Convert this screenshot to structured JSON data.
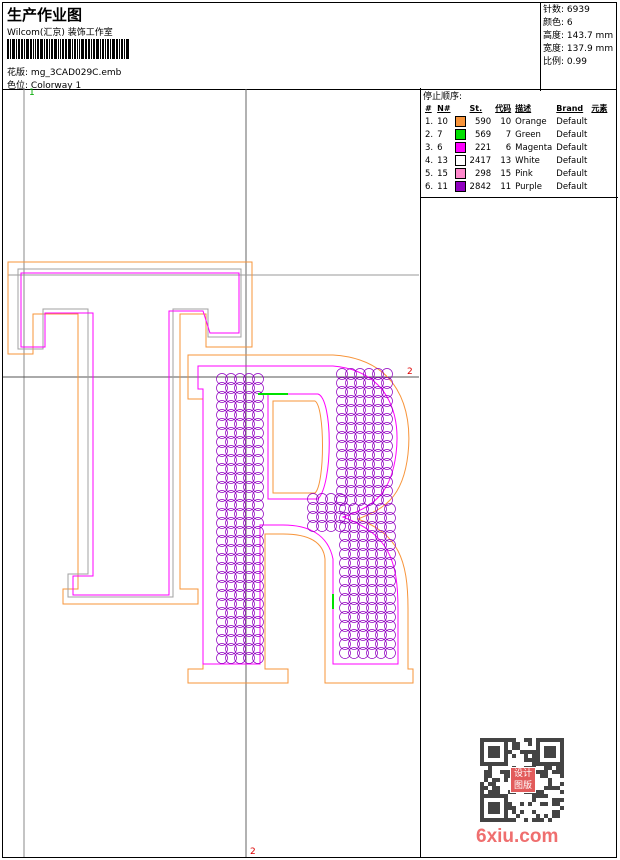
{
  "header": {
    "title": "生产作业图",
    "company": "Wilcom(汇京) 装饰工作室",
    "design_label": "花版:",
    "design_value": "mg_3CAD029C.emb",
    "colorway_label": "色位:",
    "colorway_value": "Colorway 1"
  },
  "info": [
    {
      "label": "针数:",
      "value": "6939"
    },
    {
      "label": "颜色:",
      "value": "6"
    },
    {
      "label": "高度:",
      "value": "143.7 mm"
    },
    {
      "label": "宽度:",
      "value": "137.9 mm"
    },
    {
      "label": "比例:",
      "value": "0.99"
    }
  ],
  "stop_sequence": {
    "title": "停止顺序:",
    "columns": [
      "#",
      "N#",
      "St.",
      "代码",
      "描述",
      "Brand",
      "元素"
    ],
    "rows": [
      {
        "idx": "1.",
        "n": "10",
        "color": "#f7943a",
        "st": "590",
        "code": "10",
        "desc": "Orange",
        "brand": "Default"
      },
      {
        "idx": "2.",
        "n": "7",
        "color": "#00e000",
        "st": "569",
        "code": "7",
        "desc": "Green",
        "brand": "Default"
      },
      {
        "idx": "3.",
        "n": "6",
        "color": "#ff00ff",
        "st": "221",
        "code": "6",
        "desc": "Magenta",
        "brand": "Default"
      },
      {
        "idx": "4.",
        "n": "13",
        "color": "#ffffff",
        "st": "2417",
        "code": "13",
        "desc": "White",
        "brand": "Default"
      },
      {
        "idx": "5.",
        "n": "15",
        "color": "#ff88cc",
        "st": "298",
        "code": "15",
        "desc": "Pink",
        "brand": "Default"
      },
      {
        "idx": "6.",
        "n": "11",
        "color": "#9000c0",
        "st": "2842",
        "code": "11",
        "desc": "Purple",
        "brand": "Default"
      }
    ]
  },
  "markers": {
    "top_left": "1",
    "right": "2",
    "bottom": "2"
  },
  "watermark": {
    "text": "6xiu.com",
    "stamp": "设计图版"
  }
}
